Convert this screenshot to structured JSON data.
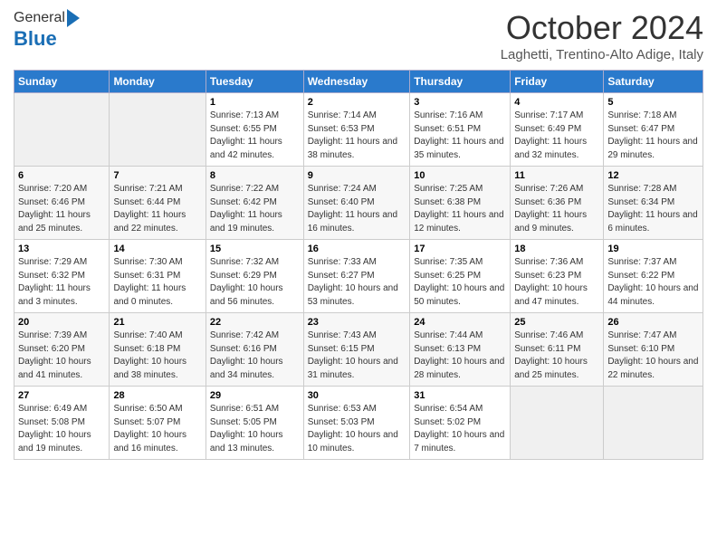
{
  "header": {
    "logo_general": "General",
    "logo_blue": "Blue",
    "month_title": "October 2024",
    "location": "Laghetti, Trentino-Alto Adige, Italy"
  },
  "days_of_week": [
    "Sunday",
    "Monday",
    "Tuesday",
    "Wednesday",
    "Thursday",
    "Friday",
    "Saturday"
  ],
  "weeks": [
    [
      {
        "day": "",
        "sunrise": "",
        "sunset": "",
        "daylight": "",
        "empty": true
      },
      {
        "day": "",
        "sunrise": "",
        "sunset": "",
        "daylight": "",
        "empty": true
      },
      {
        "day": "1",
        "sunrise": "Sunrise: 7:13 AM",
        "sunset": "Sunset: 6:55 PM",
        "daylight": "Daylight: 11 hours and 42 minutes.",
        "empty": false
      },
      {
        "day": "2",
        "sunrise": "Sunrise: 7:14 AM",
        "sunset": "Sunset: 6:53 PM",
        "daylight": "Daylight: 11 hours and 38 minutes.",
        "empty": false
      },
      {
        "day": "3",
        "sunrise": "Sunrise: 7:16 AM",
        "sunset": "Sunset: 6:51 PM",
        "daylight": "Daylight: 11 hours and 35 minutes.",
        "empty": false
      },
      {
        "day": "4",
        "sunrise": "Sunrise: 7:17 AM",
        "sunset": "Sunset: 6:49 PM",
        "daylight": "Daylight: 11 hours and 32 minutes.",
        "empty": false
      },
      {
        "day": "5",
        "sunrise": "Sunrise: 7:18 AM",
        "sunset": "Sunset: 6:47 PM",
        "daylight": "Daylight: 11 hours and 29 minutes.",
        "empty": false
      }
    ],
    [
      {
        "day": "6",
        "sunrise": "Sunrise: 7:20 AM",
        "sunset": "Sunset: 6:46 PM",
        "daylight": "Daylight: 11 hours and 25 minutes.",
        "empty": false
      },
      {
        "day": "7",
        "sunrise": "Sunrise: 7:21 AM",
        "sunset": "Sunset: 6:44 PM",
        "daylight": "Daylight: 11 hours and 22 minutes.",
        "empty": false
      },
      {
        "day": "8",
        "sunrise": "Sunrise: 7:22 AM",
        "sunset": "Sunset: 6:42 PM",
        "daylight": "Daylight: 11 hours and 19 minutes.",
        "empty": false
      },
      {
        "day": "9",
        "sunrise": "Sunrise: 7:24 AM",
        "sunset": "Sunset: 6:40 PM",
        "daylight": "Daylight: 11 hours and 16 minutes.",
        "empty": false
      },
      {
        "day": "10",
        "sunrise": "Sunrise: 7:25 AM",
        "sunset": "Sunset: 6:38 PM",
        "daylight": "Daylight: 11 hours and 12 minutes.",
        "empty": false
      },
      {
        "day": "11",
        "sunrise": "Sunrise: 7:26 AM",
        "sunset": "Sunset: 6:36 PM",
        "daylight": "Daylight: 11 hours and 9 minutes.",
        "empty": false
      },
      {
        "day": "12",
        "sunrise": "Sunrise: 7:28 AM",
        "sunset": "Sunset: 6:34 PM",
        "daylight": "Daylight: 11 hours and 6 minutes.",
        "empty": false
      }
    ],
    [
      {
        "day": "13",
        "sunrise": "Sunrise: 7:29 AM",
        "sunset": "Sunset: 6:32 PM",
        "daylight": "Daylight: 11 hours and 3 minutes.",
        "empty": false
      },
      {
        "day": "14",
        "sunrise": "Sunrise: 7:30 AM",
        "sunset": "Sunset: 6:31 PM",
        "daylight": "Daylight: 11 hours and 0 minutes.",
        "empty": false
      },
      {
        "day": "15",
        "sunrise": "Sunrise: 7:32 AM",
        "sunset": "Sunset: 6:29 PM",
        "daylight": "Daylight: 10 hours and 56 minutes.",
        "empty": false
      },
      {
        "day": "16",
        "sunrise": "Sunrise: 7:33 AM",
        "sunset": "Sunset: 6:27 PM",
        "daylight": "Daylight: 10 hours and 53 minutes.",
        "empty": false
      },
      {
        "day": "17",
        "sunrise": "Sunrise: 7:35 AM",
        "sunset": "Sunset: 6:25 PM",
        "daylight": "Daylight: 10 hours and 50 minutes.",
        "empty": false
      },
      {
        "day": "18",
        "sunrise": "Sunrise: 7:36 AM",
        "sunset": "Sunset: 6:23 PM",
        "daylight": "Daylight: 10 hours and 47 minutes.",
        "empty": false
      },
      {
        "day": "19",
        "sunrise": "Sunrise: 7:37 AM",
        "sunset": "Sunset: 6:22 PM",
        "daylight": "Daylight: 10 hours and 44 minutes.",
        "empty": false
      }
    ],
    [
      {
        "day": "20",
        "sunrise": "Sunrise: 7:39 AM",
        "sunset": "Sunset: 6:20 PM",
        "daylight": "Daylight: 10 hours and 41 minutes.",
        "empty": false
      },
      {
        "day": "21",
        "sunrise": "Sunrise: 7:40 AM",
        "sunset": "Sunset: 6:18 PM",
        "daylight": "Daylight: 10 hours and 38 minutes.",
        "empty": false
      },
      {
        "day": "22",
        "sunrise": "Sunrise: 7:42 AM",
        "sunset": "Sunset: 6:16 PM",
        "daylight": "Daylight: 10 hours and 34 minutes.",
        "empty": false
      },
      {
        "day": "23",
        "sunrise": "Sunrise: 7:43 AM",
        "sunset": "Sunset: 6:15 PM",
        "daylight": "Daylight: 10 hours and 31 minutes.",
        "empty": false
      },
      {
        "day": "24",
        "sunrise": "Sunrise: 7:44 AM",
        "sunset": "Sunset: 6:13 PM",
        "daylight": "Daylight: 10 hours and 28 minutes.",
        "empty": false
      },
      {
        "day": "25",
        "sunrise": "Sunrise: 7:46 AM",
        "sunset": "Sunset: 6:11 PM",
        "daylight": "Daylight: 10 hours and 25 minutes.",
        "empty": false
      },
      {
        "day": "26",
        "sunrise": "Sunrise: 7:47 AM",
        "sunset": "Sunset: 6:10 PM",
        "daylight": "Daylight: 10 hours and 22 minutes.",
        "empty": false
      }
    ],
    [
      {
        "day": "27",
        "sunrise": "Sunrise: 6:49 AM",
        "sunset": "Sunset: 5:08 PM",
        "daylight": "Daylight: 10 hours and 19 minutes.",
        "empty": false
      },
      {
        "day": "28",
        "sunrise": "Sunrise: 6:50 AM",
        "sunset": "Sunset: 5:07 PM",
        "daylight": "Daylight: 10 hours and 16 minutes.",
        "empty": false
      },
      {
        "day": "29",
        "sunrise": "Sunrise: 6:51 AM",
        "sunset": "Sunset: 5:05 PM",
        "daylight": "Daylight: 10 hours and 13 minutes.",
        "empty": false
      },
      {
        "day": "30",
        "sunrise": "Sunrise: 6:53 AM",
        "sunset": "Sunset: 5:03 PM",
        "daylight": "Daylight: 10 hours and 10 minutes.",
        "empty": false
      },
      {
        "day": "31",
        "sunrise": "Sunrise: 6:54 AM",
        "sunset": "Sunset: 5:02 PM",
        "daylight": "Daylight: 10 hours and 7 minutes.",
        "empty": false
      },
      {
        "day": "",
        "sunrise": "",
        "sunset": "",
        "daylight": "",
        "empty": true
      },
      {
        "day": "",
        "sunrise": "",
        "sunset": "",
        "daylight": "",
        "empty": true
      }
    ]
  ]
}
